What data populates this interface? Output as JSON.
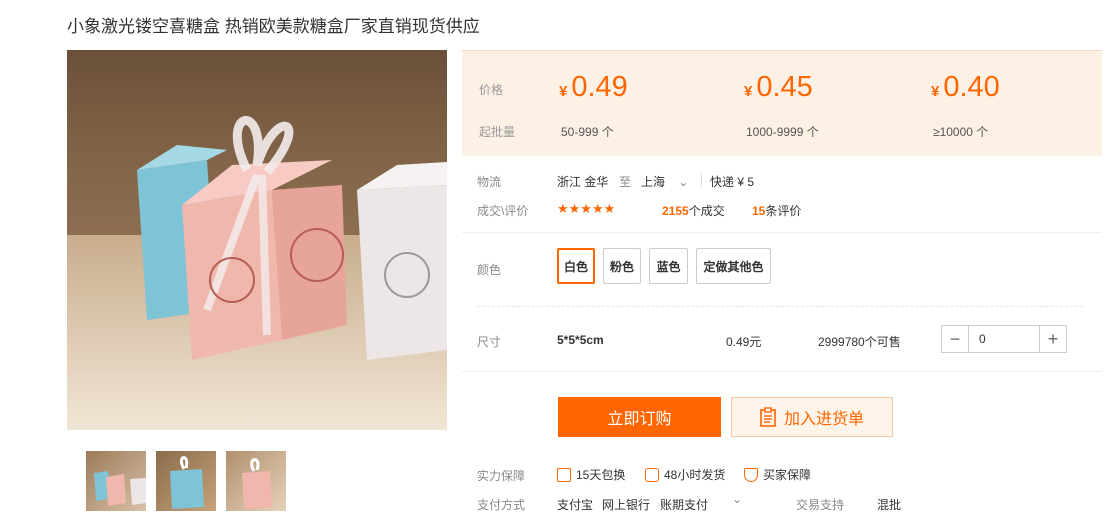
{
  "product": {
    "title": "小象激光镂空喜糖盒 热销欧美款糖盒厂家直销现货供应"
  },
  "price_box": {
    "price_label": "价格",
    "qty_label": "起批量",
    "currency": "¥",
    "tiers": [
      {
        "price": "0.49",
        "qty": "50-999 个"
      },
      {
        "price": "0.45",
        "qty": "1000-9999 个"
      },
      {
        "price": "0.40",
        "qty": "≥10000 个"
      }
    ]
  },
  "logistics": {
    "label": "物流",
    "from": "浙江 金华",
    "to_word": "至",
    "to": "上海",
    "shipping": "快递 ¥ 5"
  },
  "deals": {
    "label": "成交\\评价",
    "stars": "★★★★★",
    "deals_count": "2155",
    "deals_suffix": "个成交",
    "review_count": "15",
    "review_suffix": "条评价"
  },
  "colors": {
    "label": "颜色",
    "options": [
      "白色",
      "粉色",
      "蓝色",
      "定做其他色"
    ],
    "selected": "白色",
    "accent": "#ff6600"
  },
  "size": {
    "label": "尺寸",
    "value": "5*5*5cm",
    "unit_price": "0.49元",
    "stock": "2999780个可售",
    "quantity": "0"
  },
  "actions": {
    "buy": "立即订购",
    "cart": "加入进货单"
  },
  "guarantee": {
    "label": "实力保障",
    "items": [
      "15天包换",
      "48小时发货",
      "买家保障"
    ]
  },
  "payment": {
    "label": "支付方式",
    "methods": [
      "支付宝",
      "网上银行",
      "账期支付"
    ],
    "trade_label": "交易支持",
    "trade_value": "混批"
  }
}
